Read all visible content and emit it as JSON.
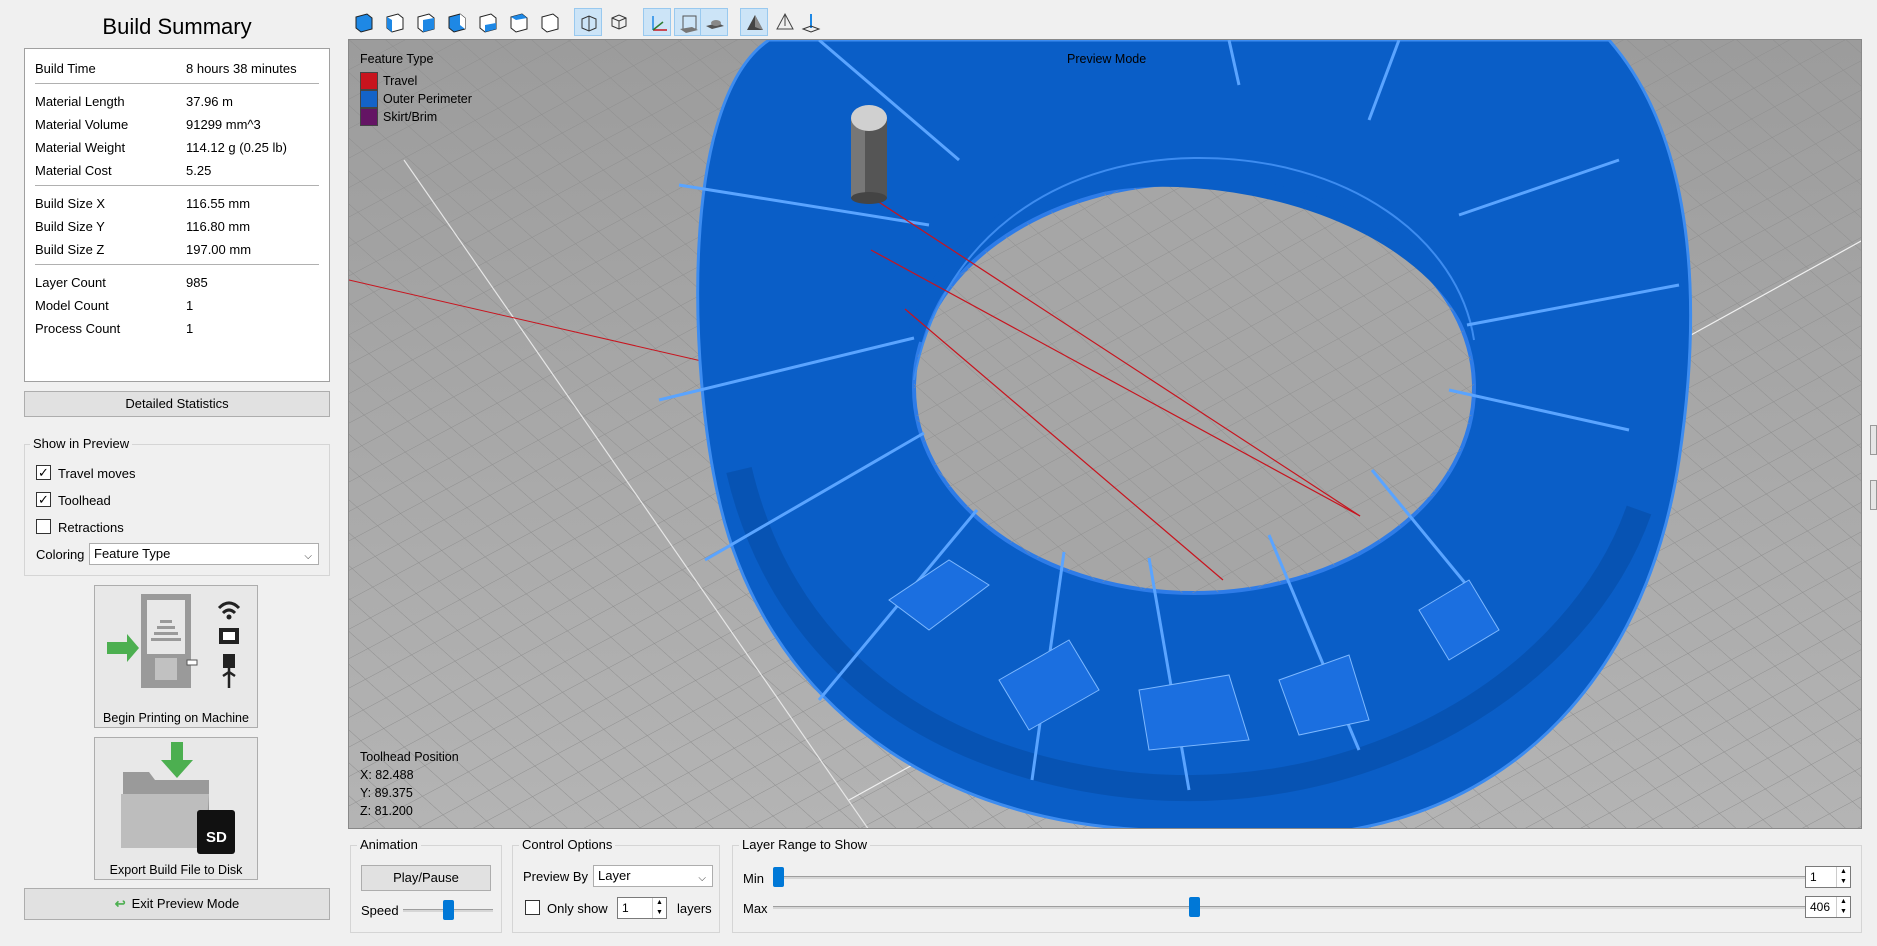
{
  "summary": {
    "title": "Build Summary",
    "stats": [
      {
        "label": "Build Time",
        "value": "8 hours 38 minutes"
      },
      {
        "label": "Material Length",
        "value": "37.96 m"
      },
      {
        "label": "Material Volume",
        "value": "91299 mm^3"
      },
      {
        "label": "Material Weight",
        "value": "114.12 g (0.25 lb)"
      },
      {
        "label": "Material Cost",
        "value": "5.25"
      },
      {
        "label": "Build Size X",
        "value": "116.55 mm"
      },
      {
        "label": "Build Size Y",
        "value": "116.80 mm"
      },
      {
        "label": "Build Size Z",
        "value": "197.00 mm"
      },
      {
        "label": "Layer Count",
        "value": "985"
      },
      {
        "label": "Model Count",
        "value": "1"
      },
      {
        "label": "Process Count",
        "value": "1"
      }
    ],
    "detailed_stats_label": "Detailed Statistics"
  },
  "show_in_preview": {
    "title": "Show in Preview",
    "options": [
      {
        "label": "Travel moves",
        "checked": true
      },
      {
        "label": "Toolhead",
        "checked": true
      },
      {
        "label": "Retractions",
        "checked": false
      }
    ],
    "coloring_label": "Coloring",
    "coloring_value": "Feature Type"
  },
  "actions": {
    "print_label": "Begin Printing on Machine",
    "export_label": "Export Build File to Disk",
    "sd_text": "SD",
    "exit_label": "Exit Preview Mode"
  },
  "viewport": {
    "mode_label": "Preview Mode",
    "legend_title": "Feature Type",
    "legend": [
      {
        "label": "Travel",
        "color": "#c8141e"
      },
      {
        "label": "Outer Perimeter",
        "color": "#1463c8"
      },
      {
        "label": "Skirt/Brim",
        "color": "#641464"
      }
    ],
    "toolhead_title": "Toolhead Position",
    "toolhead_x": "X: 82.488",
    "toolhead_y": "Y: 89.375",
    "toolhead_z": "Z: 81.200"
  },
  "animation": {
    "title": "Animation",
    "play_label": "Play/Pause",
    "speed_label": "Speed",
    "speed_level": 0.5
  },
  "control_options": {
    "title": "Control Options",
    "preview_by_label": "Preview By",
    "preview_by_value": "Layer",
    "only_show_label": "Only show",
    "only_show_value": "1",
    "layers_label": "layers"
  },
  "layer_range": {
    "title": "Layer Range to Show",
    "min_label": "Min",
    "max_label": "Max",
    "min_value": "1",
    "max_value": "406"
  },
  "colors": {
    "accent": "#0078d7",
    "model_blue": "#0a5fc8",
    "travel_red": "#c8141e"
  }
}
